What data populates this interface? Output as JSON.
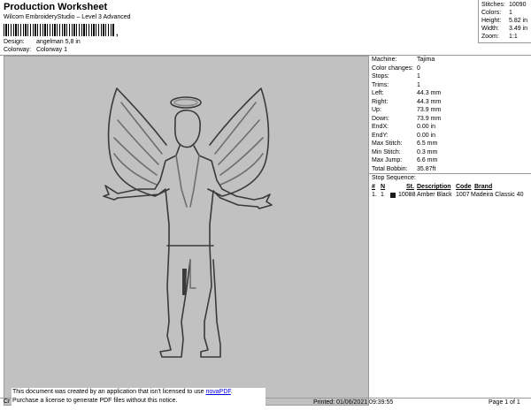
{
  "header": {
    "title": "Production Worksheet",
    "subtitle": "Wilcom EmbroideryStudio – Level 3 Advanced",
    "barcode_mark": ",",
    "design_label": "Design:",
    "design_value": "angelman 5,8 in",
    "colorway_label": "Colorway:",
    "colorway_value": "Colorway 1"
  },
  "stats": [
    {
      "label": "Stitches:",
      "value": "10090"
    },
    {
      "label": "Colors:",
      "value": "1"
    },
    {
      "label": "Height:",
      "value": "5.82 in"
    },
    {
      "label": "Width:",
      "value": "3.49 in"
    },
    {
      "label": "Zoom:",
      "value": "1:1"
    }
  ],
  "machine": [
    {
      "label": "Machine:",
      "value": "Tajima"
    },
    {
      "label": "Color changes:",
      "value": "0"
    },
    {
      "label": "Stops:",
      "value": "1"
    },
    {
      "label": "Trims:",
      "value": "1"
    },
    {
      "label": "Left:",
      "value": "44.3 mm"
    },
    {
      "label": "Right:",
      "value": "44.3 mm"
    },
    {
      "label": "Up:",
      "value": "73.9 mm"
    },
    {
      "label": "Down:",
      "value": "73.9 mm"
    },
    {
      "label": "EndX:",
      "value": "0.00 in"
    },
    {
      "label": "EndY:",
      "value": "0.00 in"
    },
    {
      "label": "Max Stitch:",
      "value": "6.5 mm"
    },
    {
      "label": "Min Stitch:",
      "value": "0.3 mm"
    },
    {
      "label": "Max Jump:",
      "value": "6.6 mm"
    },
    {
      "label": "Total Bobbin:",
      "value": "35.87ft"
    }
  ],
  "stop_sequence": {
    "title": "Stop Sequence:",
    "headers": [
      "#",
      "N",
      "St.",
      "Description",
      "Code",
      "Brand"
    ],
    "rows": [
      {
        "num": "1.",
        "n": "1",
        "st": "10088",
        "description": "Amber Black",
        "code": "1007",
        "brand": "Madeira Classic 40",
        "color": "#1a1a1a"
      }
    ]
  },
  "footer": {
    "note_line1": "This document was created by an application that isn't licensed to use",
    "note_link": "novaPDF",
    "note_period": ".",
    "note_line2": "Purchase a license to generate PDF files without this notice.",
    "cr": "Cr",
    "printed": "Printed: 01/06/2021 09:39:55",
    "page": "Page 1 of 1"
  },
  "colors": {
    "background": "#c1c1c1",
    "stitch_outline": "#3a3a3a",
    "stitch_highlight": "#8c8c8c"
  }
}
